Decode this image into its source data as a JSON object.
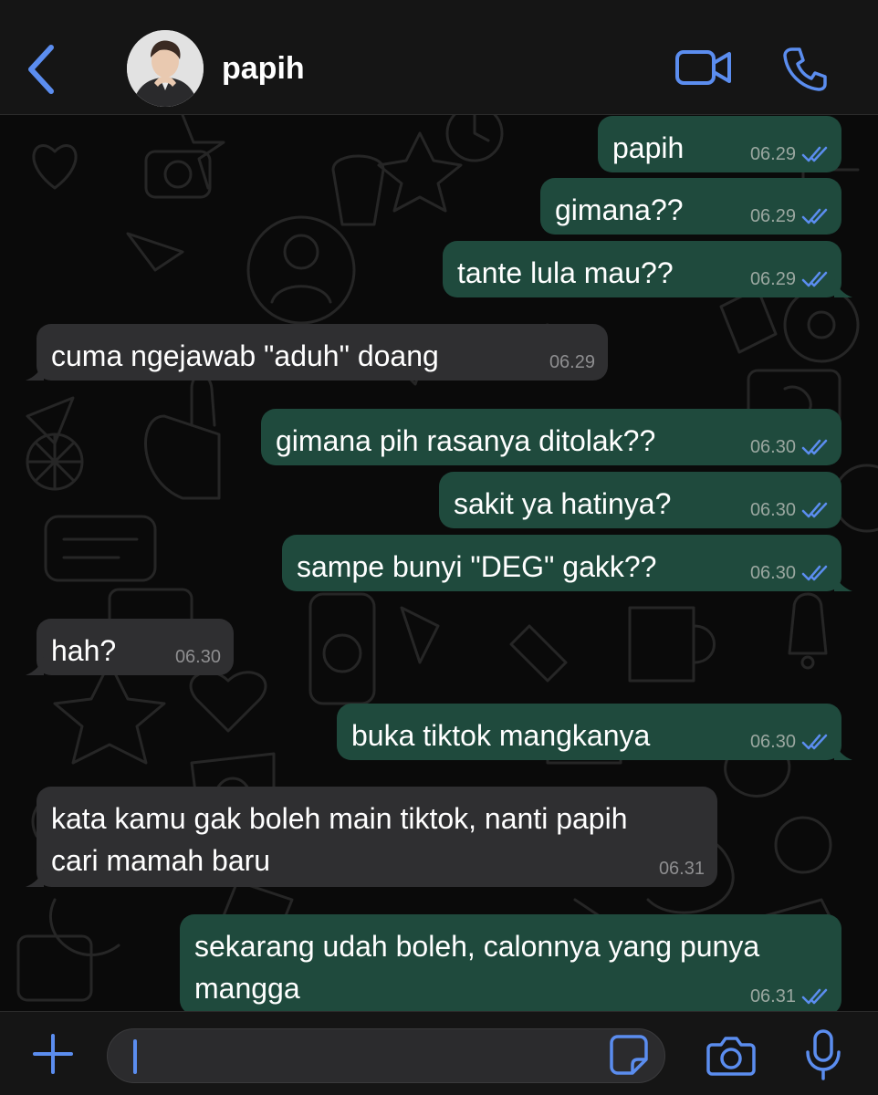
{
  "header": {
    "contact_name": "papih",
    "accent_color": "#5b8def"
  },
  "messages": [
    {
      "direction": "outgoing",
      "text": "papih",
      "time": "06.29",
      "status": "read"
    },
    {
      "direction": "outgoing",
      "text": "gimana??",
      "time": "06.29",
      "status": "read"
    },
    {
      "direction": "outgoing",
      "text": "tante lula mau??",
      "time": "06.29",
      "status": "read"
    },
    {
      "direction": "incoming",
      "text": "cuma ngejawab \"aduh\" doang",
      "time": "06.29"
    },
    {
      "direction": "outgoing",
      "text": "gimana pih rasanya ditolak??",
      "time": "06.30",
      "status": "read"
    },
    {
      "direction": "outgoing",
      "text": "sakit ya hatinya?",
      "time": "06.30",
      "status": "read"
    },
    {
      "direction": "outgoing",
      "text": "sampe bunyi \"DEG\" gakk??",
      "time": "06.30",
      "status": "read"
    },
    {
      "direction": "incoming",
      "text": "hah?",
      "time": "06.30"
    },
    {
      "direction": "outgoing",
      "text": "buka tiktok mangkanya",
      "time": "06.30",
      "status": "read"
    },
    {
      "direction": "incoming",
      "text_line1": "kata kamu gak boleh main tiktok, nanti papih",
      "text_line2": "cari mamah baru",
      "time": "06.31"
    },
    {
      "direction": "outgoing",
      "text_line1": "sekarang udah boleh, calonnya yang punya",
      "text_line2": "mangga",
      "time": "06.31",
      "status": "read"
    }
  ],
  "colors": {
    "outgoing_bubble": "#1f4a3d",
    "incoming_bubble": "#2f2f31",
    "read_tick": "#5b8def"
  },
  "icons": {
    "back": "chevron-left-icon",
    "video": "video-camera-icon",
    "call": "phone-icon",
    "attach": "plus-icon",
    "sticker": "sticker-icon",
    "camera": "camera-icon",
    "mic": "microphone-icon"
  }
}
